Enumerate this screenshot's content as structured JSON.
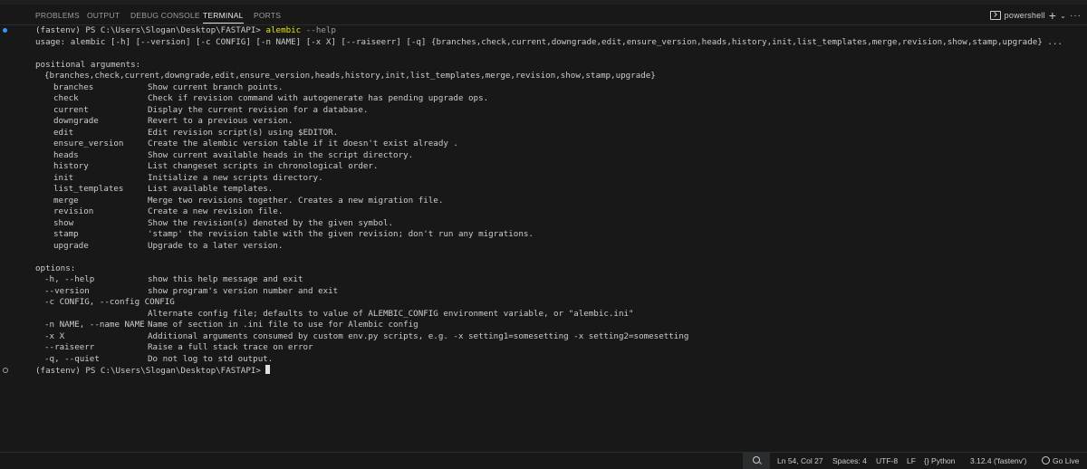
{
  "panel": {
    "tabs": [
      "PROBLEMS",
      "OUTPUT",
      "DEBUG CONSOLE",
      "TERMINAL",
      "PORTS"
    ],
    "active_tab": "TERMINAL",
    "terminal_name": "powershell"
  },
  "terminal": {
    "prompt": "(fastenv) PS C:\\Users\\Slogan\\Desktop\\FASTAPI>",
    "command": "alembic",
    "command_args": "--help",
    "usage": "usage: alembic [-h] [--version] [-c CONFIG] [-n NAME] [-x X] [--raiseerr] [-q] {branches,check,current,downgrade,edit,ensure_version,heads,history,init,list_templates,merge,revision,show,stamp,upgrade} ...",
    "positional_header": "positional arguments:",
    "positional_choices": "{branches,check,current,downgrade,edit,ensure_version,heads,history,init,list_templates,merge,revision,show,stamp,upgrade}",
    "commands": [
      {
        "name": "branches",
        "desc": "Show current branch points."
      },
      {
        "name": "check",
        "desc": "Check if revision command with autogenerate has pending upgrade ops."
      },
      {
        "name": "current",
        "desc": "Display the current revision for a database."
      },
      {
        "name": "downgrade",
        "desc": "Revert to a previous version."
      },
      {
        "name": "edit",
        "desc": "Edit revision script(s) using $EDITOR."
      },
      {
        "name": "ensure_version",
        "desc": "Create the alembic version table if it doesn't exist already ."
      },
      {
        "name": "heads",
        "desc": "Show current available heads in the script directory."
      },
      {
        "name": "history",
        "desc": "List changeset scripts in chronological order."
      },
      {
        "name": "init",
        "desc": "Initialize a new scripts directory."
      },
      {
        "name": "list_templates",
        "desc": "List available templates."
      },
      {
        "name": "merge",
        "desc": "Merge two revisions together. Creates a new migration file."
      },
      {
        "name": "revision",
        "desc": "Create a new revision file."
      },
      {
        "name": "show",
        "desc": "Show the revision(s) denoted by the given symbol."
      },
      {
        "name": "stamp",
        "desc": "'stamp' the revision table with the given revision; don't run any migrations."
      },
      {
        "name": "upgrade",
        "desc": "Upgrade to a later version."
      }
    ],
    "options_header": "options:",
    "options": [
      {
        "flag": "-h, --help",
        "desc": "show this help message and exit"
      },
      {
        "flag": "--version",
        "desc": "show program's version number and exit"
      },
      {
        "flag": "-c CONFIG, --config CONFIG",
        "desc": ""
      },
      {
        "flag": "",
        "desc": "Alternate config file; defaults to value of ALEMBIC_CONFIG environment variable, or \"alembic.ini\""
      },
      {
        "flag": "-n NAME, --name NAME",
        "desc": "Name of section in .ini file to use for Alembic config"
      },
      {
        "flag": "-x X",
        "desc": "Additional arguments consumed by custom env.py scripts, e.g. -x setting1=somesetting -x setting2=somesetting"
      },
      {
        "flag": "--raiseerr",
        "desc": "Raise a full stack trace on error"
      },
      {
        "flag": "-q, --quiet",
        "desc": "Do not log to std output."
      }
    ]
  },
  "statusbar": {
    "position": "Ln 54, Col 27",
    "spaces": "Spaces: 4",
    "encoding": "UTF-8",
    "eol": "LF",
    "language": "{} Python",
    "interpreter": "3.12.4 ('fastenv')",
    "golive": "Go Live"
  },
  "colors": {
    "background": "#181818",
    "text": "#cccccc",
    "command": "#e5e510",
    "decoration_success": "#3794ff"
  }
}
